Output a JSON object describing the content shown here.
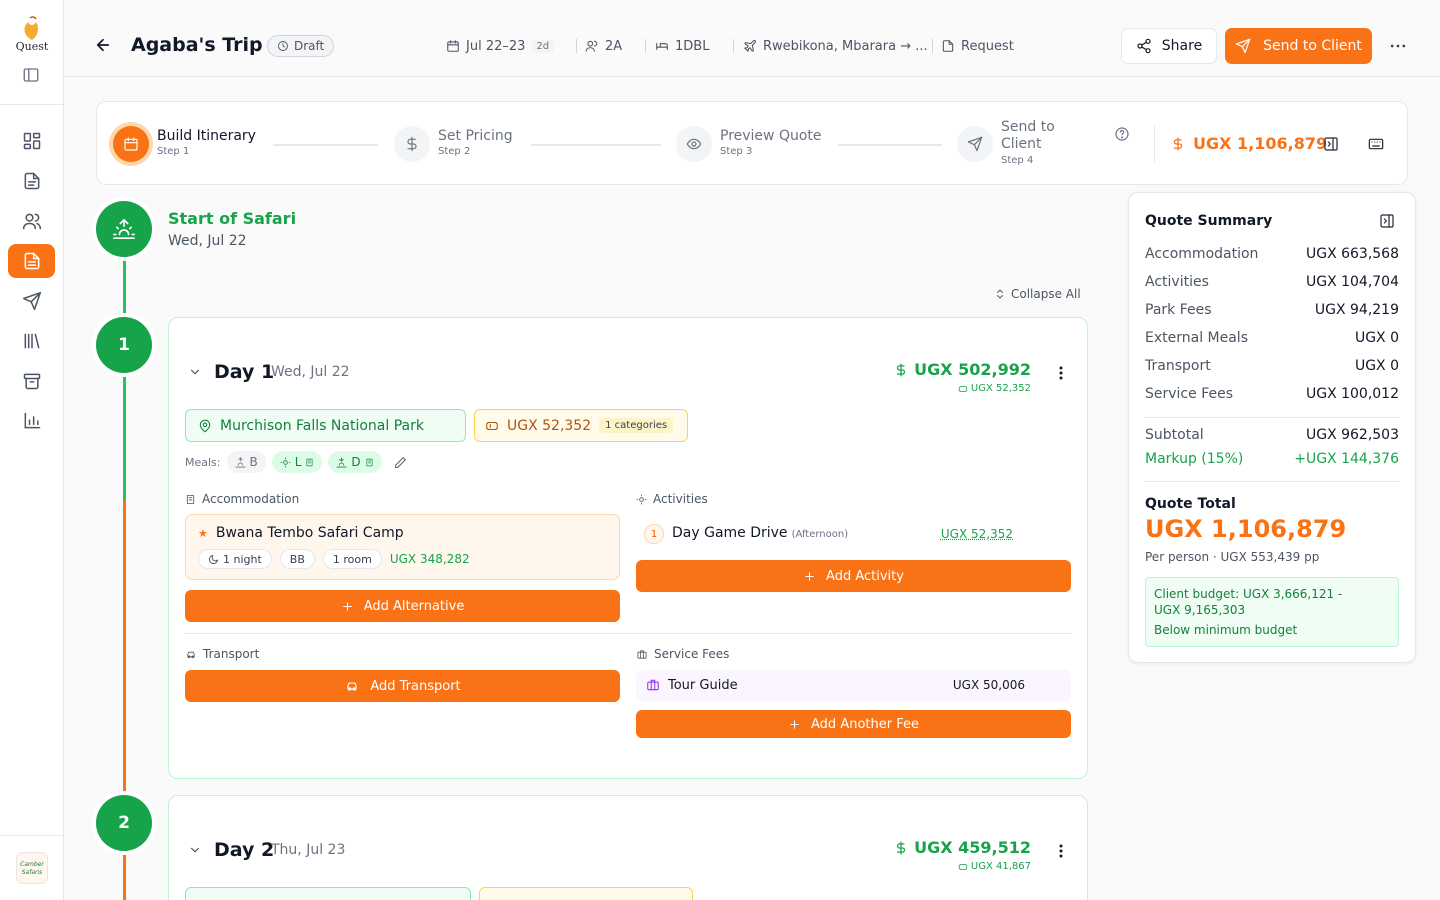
{
  "app": {
    "logo_text": "Quest",
    "brand_text": "Camber Safaris"
  },
  "header": {
    "title": "Agaba's Trip",
    "status": "Draft",
    "dates": "Jul 22–23",
    "duration": "2d",
    "travellers": "2A",
    "rooms": "1DBL",
    "route": "Rwebikona, Mbarara → ...",
    "request": "Request",
    "share_label": "Share",
    "send_label": "Send to Client"
  },
  "stepper": {
    "steps": [
      {
        "label": "Build Itinerary",
        "sub": "Step 1"
      },
      {
        "label": "Set Pricing",
        "sub": "Step 2"
      },
      {
        "label": "Preview Quote",
        "sub": "Step 3"
      },
      {
        "label": "Send to\nClient",
        "sub": "Step 4"
      }
    ],
    "total": "UGX 1,106,879"
  },
  "start": {
    "title": "Start of Safari",
    "date": "Wed, Jul 22"
  },
  "collapse_all": "Collapse All",
  "days": [
    {
      "number": "1",
      "title": "Day 1",
      "date": "Wed, Jul 22",
      "price": "UGX 502,992",
      "sub_price": "UGX 52,352",
      "park": "Murchison Falls National Park",
      "park_fee": "UGX 52,352",
      "park_fee_categories": "1 categories",
      "meals_label": "Meals:",
      "meals": [
        {
          "code": "B",
          "on": false
        },
        {
          "code": "L",
          "on": true
        },
        {
          "code": "D",
          "on": true
        }
      ],
      "accommodation_label": "Accommodation",
      "accommodation": {
        "name": "Bwana Tembo Safari Camp",
        "nights": "1 night",
        "board": "BB",
        "rooms": "1 room",
        "price": "UGX 348,282"
      },
      "add_alternative": "Add Alternative",
      "activities_label": "Activities",
      "activities": [
        {
          "num": "1",
          "name": "Day Game Drive",
          "time": "(Afternoon)",
          "price": "UGX 52,352"
        }
      ],
      "add_activity": "Add Activity",
      "transport_label": "Transport",
      "add_transport": "Add Transport",
      "service_fees_label": "Service Fees",
      "service_fees": [
        {
          "name": "Tour Guide",
          "amount": "UGX 50,006"
        }
      ],
      "add_fee": "Add Another Fee"
    },
    {
      "number": "2",
      "title": "Day 2",
      "date": "Thu, Jul 23",
      "price": "UGX 459,512",
      "sub_price": "UGX 41,867"
    }
  ],
  "summary": {
    "title": "Quote Summary",
    "rows": [
      {
        "label": "Accommodation",
        "value": "UGX 663,568"
      },
      {
        "label": "Activities",
        "value": "UGX 104,704"
      },
      {
        "label": "Park Fees",
        "value": "UGX 94,219"
      },
      {
        "label": "External Meals",
        "value": "UGX 0"
      },
      {
        "label": "Transport",
        "value": "UGX 0"
      },
      {
        "label": "Service Fees",
        "value": "UGX 100,012"
      }
    ],
    "subtotal_label": "Subtotal",
    "subtotal": "UGX 962,503",
    "markup_label": "Markup (15%)",
    "markup": "+UGX 144,376",
    "total_label": "Quote Total",
    "total": "UGX 1,106,879",
    "per_person": "Per person · UGX 553,439 pp",
    "budget_line1": "Client budget: UGX 3,666,121 -",
    "budget_line2": "UGX 9,165,303",
    "budget_status": "Below minimum budget"
  },
  "colors": {
    "accent": "#f97316",
    "success": "#16a34a"
  }
}
